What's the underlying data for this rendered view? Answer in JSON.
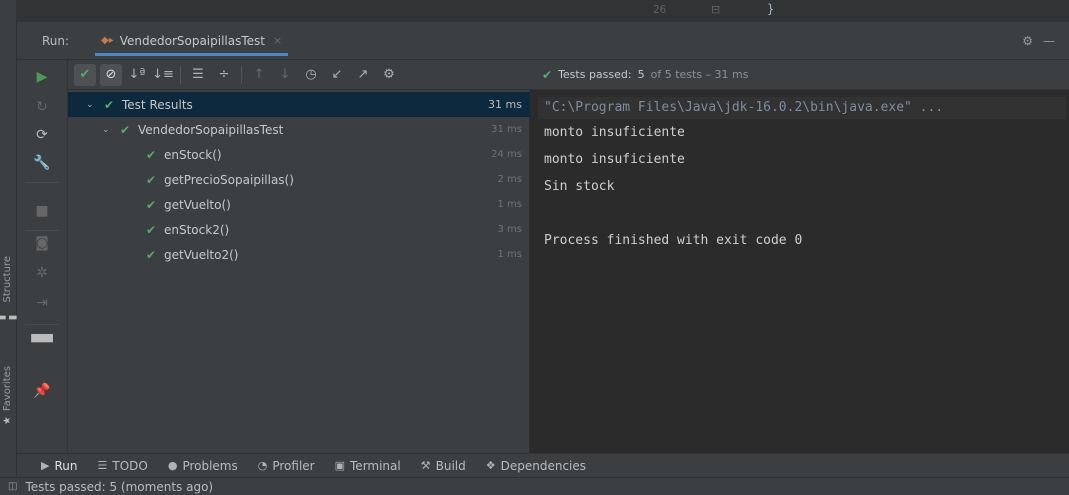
{
  "editor": {
    "line_number": "26",
    "fold_icon": "fold-icon",
    "code_text": "}"
  },
  "run_header": {
    "label": "Run:",
    "tab_name": "VendedorSopaipillasTest",
    "tab_close": "×",
    "settings_icon": "gear-icon",
    "hide_icon": "minus-icon"
  },
  "console_bar": {
    "passed_label": "Tests passed:",
    "passed_count": "5",
    "passed_rest": "of 5 tests – 31 ms"
  },
  "tree": {
    "root": {
      "label": "Test Results",
      "duration": "31 ms"
    },
    "suite": {
      "label": "VendedorSopaipillasTest",
      "duration": "31 ms"
    },
    "tests": [
      {
        "label": "enStock()",
        "duration": "24 ms"
      },
      {
        "label": "getPrecioSopaipillas()",
        "duration": "2 ms"
      },
      {
        "label": "getVuelto()",
        "duration": "1 ms"
      },
      {
        "label": "enStock2()",
        "duration": "3 ms"
      },
      {
        "label": "getVuelto2()",
        "duration": "1 ms"
      }
    ]
  },
  "console": {
    "lines": [
      "\"C:\\Program Files\\Java\\jdk-16.0.2\\bin\\java.exe\" ...",
      "monto insuficiente",
      "monto insuficiente",
      "Sin stock",
      "",
      "Process finished with exit code 0"
    ]
  },
  "side_labels": {
    "structure": "Structure",
    "favorites": "Favorites"
  },
  "bottom_tabs": [
    {
      "label": "Run",
      "icon": "play-icon"
    },
    {
      "label": "TODO",
      "icon": "list-icon"
    },
    {
      "label": "Problems",
      "icon": "info-icon"
    },
    {
      "label": "Profiler",
      "icon": "profiler-icon"
    },
    {
      "label": "Terminal",
      "icon": "terminal-icon"
    },
    {
      "label": "Build",
      "icon": "hammer-icon"
    },
    {
      "label": "Dependencies",
      "icon": "dependencies-icon"
    }
  ],
  "status": {
    "text": "Tests passed: 5 (moments ago)"
  },
  "colors": {
    "accent": "#4a88c7",
    "pass": "#59a869",
    "run": "#499c54",
    "selection": "#0d293e"
  }
}
